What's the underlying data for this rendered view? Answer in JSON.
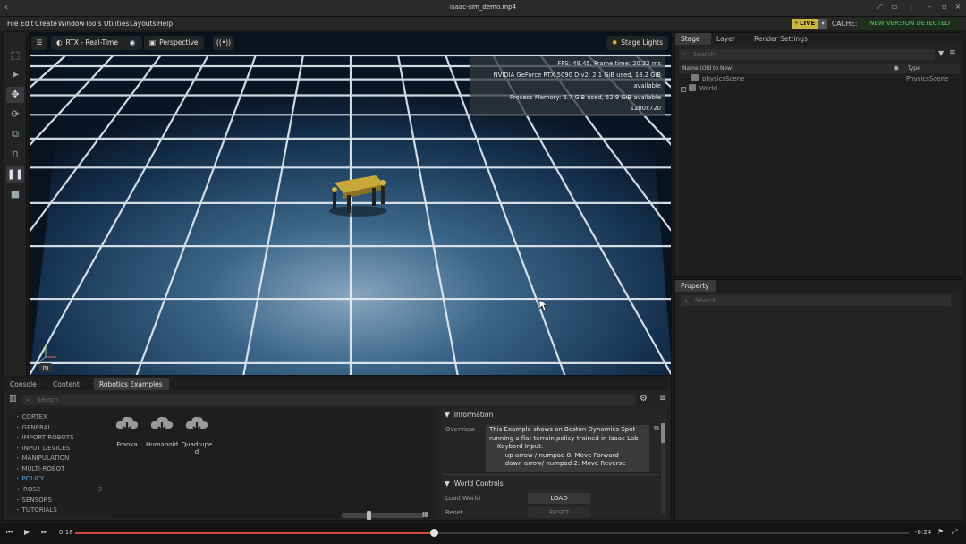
{
  "window": {
    "title": "isaac-sim_demo.mp4"
  },
  "menubar": {
    "items": [
      "File",
      "Edit",
      "Create",
      "Window",
      "Tools",
      "Utilities",
      "Layouts",
      "Help"
    ],
    "live_label": "LIVE",
    "cache_label": "CACHE:",
    "new_version_label": "NEW VERSION DETECTED",
    "colors": {
      "live": "#c9b640",
      "new_version": "#4fd24f"
    }
  },
  "viewport": {
    "render_mode": "RTX - Real-Time",
    "camera": "Perspective",
    "lights": "Stage Lights",
    "stats": [
      "FPS: 49.45, Frame time: 20.22 ms",
      "NVIDIA GeForce RTX 5090 D v2: 2.1 GiB used, 18.2 GiB available",
      "Process Memory: 6.7 GiB used, 52.9 GiB available",
      "1280x720"
    ],
    "axis_button": "m"
  },
  "stage": {
    "tabs": [
      "Stage",
      "Layer",
      "Render Settings"
    ],
    "active_tab": "Stage",
    "search_placeholder": "Search",
    "columns": {
      "name": "Name (Old to New)",
      "type": "Type"
    },
    "rows": [
      {
        "name": "physicsScene",
        "type": "PhysicsScene"
      },
      {
        "name": "World",
        "type": ""
      }
    ]
  },
  "property": {
    "tab": "Property",
    "search_placeholder": "Search"
  },
  "bottom": {
    "tabs": [
      "Console",
      "Content",
      "Robotics Examples"
    ],
    "active_tab": "Robotics Examples",
    "search_placeholder": "Search",
    "categories": [
      {
        "label": "CORTEX",
        "count": ""
      },
      {
        "label": "GENERAL",
        "count": ""
      },
      {
        "label": "IMPORT ROBOTS",
        "count": ""
      },
      {
        "label": "INPUT DEVICES",
        "count": ""
      },
      {
        "label": "MANIPULATION",
        "count": ""
      },
      {
        "label": "MULTI-ROBOT",
        "count": ""
      },
      {
        "label": "POLICY",
        "count": ""
      },
      {
        "label": "ROS2",
        "count": "3"
      },
      {
        "label": "SENSORS",
        "count": ""
      },
      {
        "label": "TUTORIALS",
        "count": ""
      }
    ],
    "active_category": "POLICY",
    "examples": [
      {
        "label": "Franka"
      },
      {
        "label": "Humanoid"
      },
      {
        "label": "Quadruped"
      }
    ],
    "info": {
      "header": "Information",
      "overview_label": "Overview",
      "overview_text": "This Example shows an Boston Dynamics Spot\nrunning a flat terrain policy trained in Isaac Lab\n    Keybord Input:\n        up arrow / numpad 8: Move Forward\n        down arrow/ numpad 2: Move Reverse",
      "world_controls_header": "World Controls",
      "load_world_label": "Load World",
      "load_button": "LOAD",
      "reset_label": "Reset",
      "reset_button": "RESET"
    }
  },
  "player": {
    "elapsed": "0:18",
    "remaining": "-0:24",
    "progress": 0.43,
    "colors": {
      "progress": "#d24a3a"
    }
  }
}
